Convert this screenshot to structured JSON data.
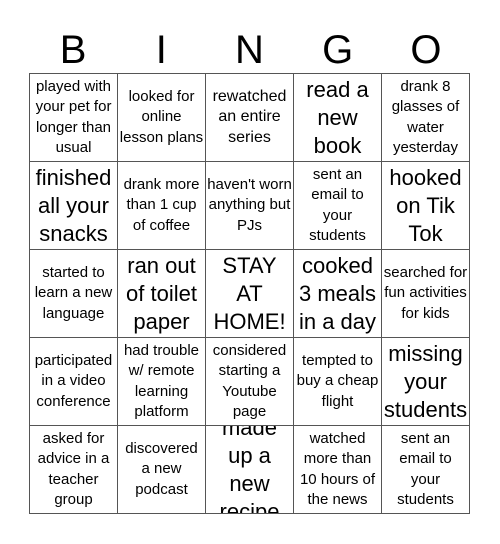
{
  "header": [
    "B",
    "I",
    "N",
    "G",
    "O"
  ],
  "cells": [
    {
      "text": "played with your pet for longer than usual",
      "size": "s1"
    },
    {
      "text": "looked for online lesson plans",
      "size": "s1"
    },
    {
      "text": "rewatched an entire series",
      "size": "s2"
    },
    {
      "text": "read a new book",
      "size": "s3"
    },
    {
      "text": "drank 8 glasses of water yesterday",
      "size": "s1"
    },
    {
      "text": "finished all your snacks",
      "size": "s3"
    },
    {
      "text": "drank more than 1 cup of coffee",
      "size": "s1"
    },
    {
      "text": "haven't worn anything but PJs",
      "size": "s1"
    },
    {
      "text": "sent an email to your students",
      "size": "s1"
    },
    {
      "text": "hooked on Tik Tok",
      "size": "s3"
    },
    {
      "text": "started to learn a new language",
      "size": "s1"
    },
    {
      "text": "ran out of toilet paper",
      "size": "s3"
    },
    {
      "text": "STAY AT HOME!",
      "size": "s3"
    },
    {
      "text": "cooked 3 meals in a day",
      "size": "s3"
    },
    {
      "text": "searched for fun activities for kids",
      "size": "s1"
    },
    {
      "text": "participated in a video conference",
      "size": "s1"
    },
    {
      "text": "had trouble w/ remote learning platform",
      "size": "s1"
    },
    {
      "text": "considered starting a Youtube page",
      "size": "s1"
    },
    {
      "text": "tempted to buy a cheap flight",
      "size": "s1"
    },
    {
      "text": "missing your students",
      "size": "s3"
    },
    {
      "text": "asked for advice in a teacher group",
      "size": "s1"
    },
    {
      "text": "discovered a new podcast",
      "size": "s1"
    },
    {
      "text": "made up a new recipe",
      "size": "s3"
    },
    {
      "text": "watched more than 10 hours of the news",
      "size": "s1"
    },
    {
      "text": "sent an email to your students",
      "size": "s1"
    }
  ]
}
